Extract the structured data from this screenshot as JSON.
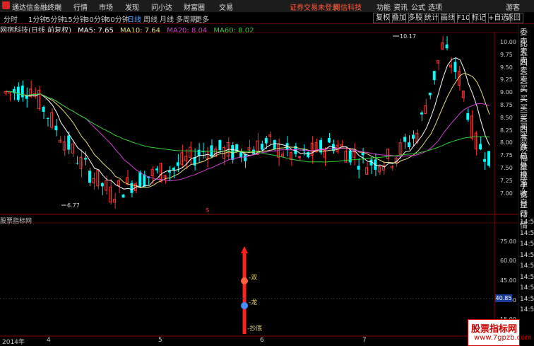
{
  "titlebar": {
    "app_title": "通达信金融终端",
    "menus": [
      "行情",
      "市场",
      "发现",
      "问小达",
      "财富圈",
      "交易"
    ],
    "login_notice": "证券交易未登录",
    "broker": "网信科技",
    "right_menus": [
      "功能",
      "资讯",
      "公式",
      "选项"
    ],
    "guest": "游客"
  },
  "toolbar": {
    "periods": [
      "分时",
      "1分钟",
      "5分钟",
      "15分钟",
      "30分钟",
      "60分钟",
      "日线",
      "周线",
      "月线",
      "多周期",
      "更多"
    ],
    "active_period": "日线",
    "right_buttons": [
      "复权",
      "叠加",
      "多股",
      "统计",
      "画线",
      "F10",
      "标记",
      "+自选",
      "返回"
    ]
  },
  "info": {
    "stock_name": "网宿科技(日线 前复权)",
    "ma5_label": "MA5: 7.65",
    "ma10_label": "MA10: 7.64",
    "ma20_label": "MA20: 8.04",
    "ma60_label": "MA60: 8.02"
  },
  "colors": {
    "up": "#ff3232",
    "down": "#00ffff",
    "ma5": "#ffffff",
    "ma10": "#e8e080",
    "ma20": "#d040d0",
    "ma60": "#30d030"
  },
  "price_axis": [
    "10.00",
    "9.75",
    "9.50",
    "9.25",
    "9.00",
    "8.75",
    "8.50",
    "8.25",
    "8.00",
    "7.75",
    "7.50",
    "7.25",
    "7.00"
  ],
  "annotations": {
    "high": "10.17",
    "low": "6.77",
    "s_marker": "S"
  },
  "right_panel": [
    "委比",
    "卖五",
    "卖四",
    "卖三",
    "卖二",
    "卖一",
    "买一",
    "买二",
    "买三",
    "买四",
    "买五",
    "涨跌",
    "涨幅",
    "总量",
    "外盘",
    "换手",
    "净资",
    "收益",
    "自动",
    "行情",
    "14:50",
    "14:50",
    "14:50",
    "14:50",
    "14:50",
    "14:50",
    "14:50",
    "14:50",
    "14:50"
  ],
  "indicator": {
    "title": "股票指标网",
    "axis": [
      "75.00",
      "60.00",
      "45.00",
      "30.00",
      "15.00"
    ],
    "value_tag": "40.85",
    "labels": [
      "-双",
      "-龙",
      "-抄底"
    ]
  },
  "date_axis": [
    "2014年",
    "4",
    "5",
    "6",
    "7"
  ],
  "watermark": {
    "line1": "股票指标网",
    "line2": "www.7gpzb.com"
  }
}
